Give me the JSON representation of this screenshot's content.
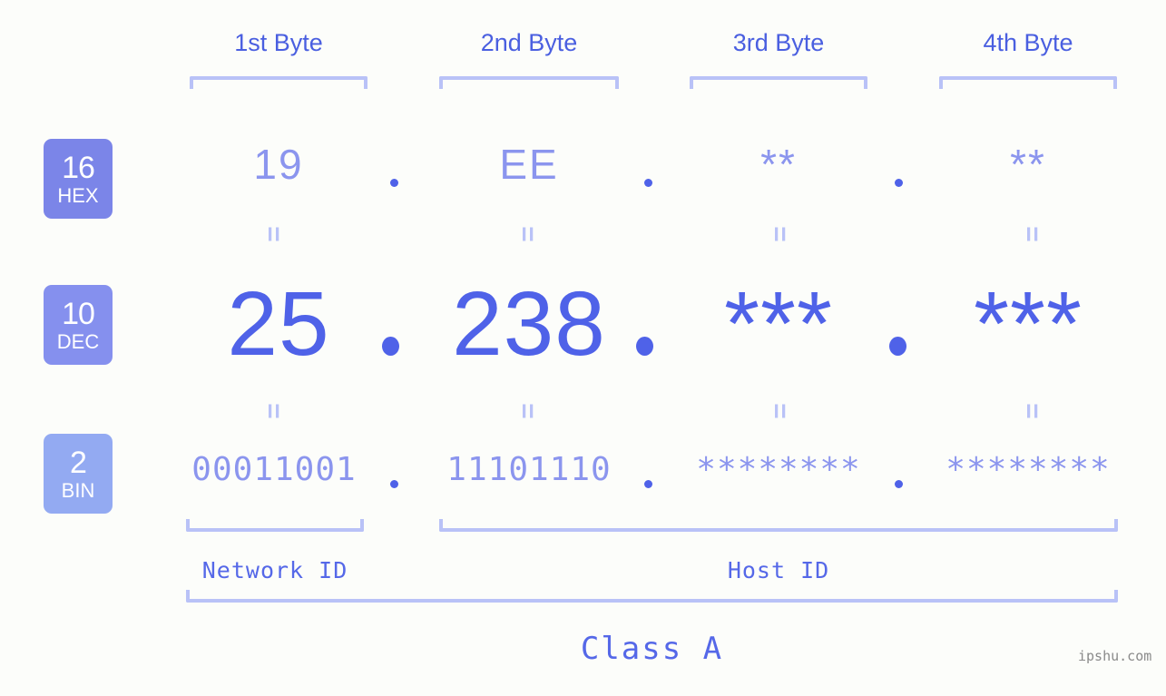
{
  "colors": {
    "background": "#fcfdfa",
    "accent_strong": "#4f62e8",
    "accent_mid": "#8b95ee",
    "accent_light": "#b9c2f7",
    "badge_hex": "#7b85e8",
    "badge_dec": "#8590ee",
    "badge_bin": "#93aaf2",
    "watermark": "#8a8a8a"
  },
  "byte_headers": [
    {
      "label": "1st Byte"
    },
    {
      "label": "2nd Byte"
    },
    {
      "label": "3rd Byte"
    },
    {
      "label": "4th Byte"
    }
  ],
  "rows": [
    {
      "base": "16",
      "abbr": "HEX",
      "values": [
        "19",
        "EE",
        "**",
        "**"
      ],
      "separator": "."
    },
    {
      "base": "10",
      "abbr": "DEC",
      "values": [
        "25",
        "238",
        "***",
        "***"
      ],
      "separator": "."
    },
    {
      "base": "2",
      "abbr": "BIN",
      "values": [
        "00011001",
        "11101110",
        "********",
        "********"
      ],
      "separator": "."
    }
  ],
  "equals_sign": "=",
  "id_groups": [
    {
      "label": "Network ID"
    },
    {
      "label": "Host ID"
    }
  ],
  "class": {
    "label": "Class A"
  },
  "watermark": {
    "text": "ipshu.com"
  }
}
